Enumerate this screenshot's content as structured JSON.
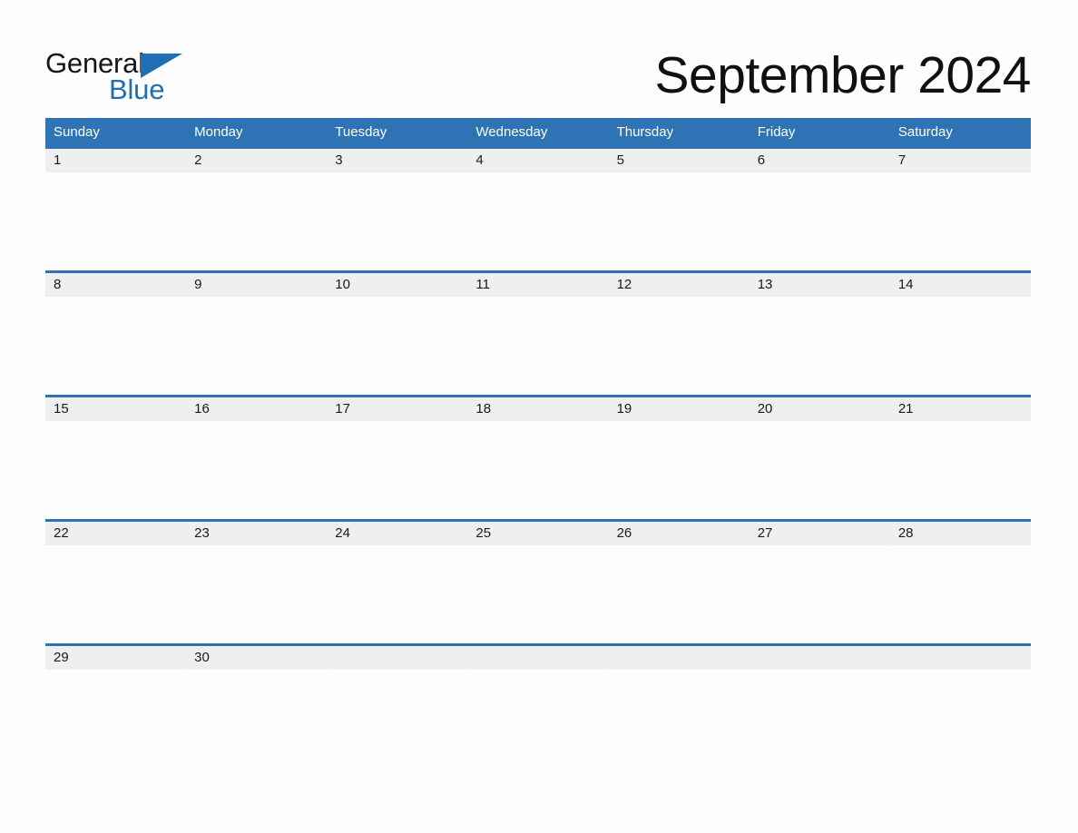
{
  "brand": {
    "line1": "General",
    "line2": "Blue",
    "triangle_icon": "triangle-icon",
    "color_black": "#17171a",
    "color_blue": "#1f6fb2"
  },
  "header": {
    "title": "September 2024"
  },
  "theme": {
    "header_blue": "#2e73b4",
    "date_band_gray": "#efefef",
    "page_background": "#fdfdfd",
    "text_dark": "#1a1a1a",
    "header_text": "#ffffff"
  },
  "calendar": {
    "month": "September",
    "year": "2024",
    "weekday_headers": [
      "Sunday",
      "Monday",
      "Tuesday",
      "Wednesday",
      "Thursday",
      "Friday",
      "Saturday"
    ],
    "weeks": [
      {
        "days": [
          "1",
          "2",
          "3",
          "4",
          "5",
          "6",
          "7"
        ]
      },
      {
        "days": [
          "8",
          "9",
          "10",
          "11",
          "12",
          "13",
          "14"
        ]
      },
      {
        "days": [
          "15",
          "16",
          "17",
          "18",
          "19",
          "20",
          "21"
        ]
      },
      {
        "days": [
          "22",
          "23",
          "24",
          "25",
          "26",
          "27",
          "28"
        ]
      },
      {
        "days": [
          "29",
          "30",
          "",
          "",
          "",
          "",
          ""
        ]
      }
    ]
  }
}
